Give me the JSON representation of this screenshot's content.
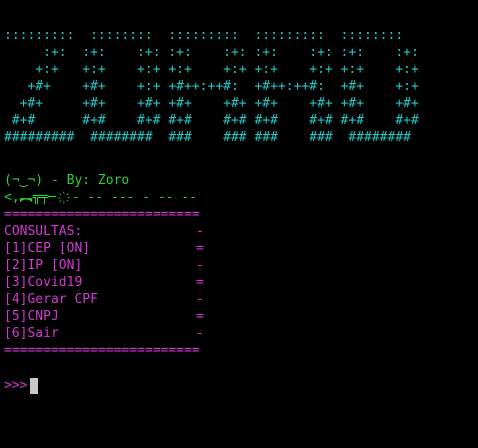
{
  "banner_art": [
    ":::::::::  ::::::::  :::::::::  :::::::::  ::::::::",
    "     :+:  :+:    :+: :+:    :+: :+:    :+: :+:    :+:",
    "    +:+   +:+    +:+ +:+    +:+ +:+    +:+ +:+    +:+",
    "   +#+    +#+    +:+ +#++:++#:  +#++:++#:  +#+    +:+",
    "  +#+     +#+    +#+ +#+    +#+ +#+    +#+ +#+    +#+",
    " #+#      #+#    #+# #+#    #+# #+#    #+# #+#    #+#",
    "#########  ########  ###    ### ###    ###  ########"
  ],
  "signature": {
    "face_text": "(¬‿¬) - By: Zoro",
    "weapon_text": "<,︻╦╤─ ҉ - -- --- - -- --"
  },
  "menu": {
    "divider": "=========================",
    "title": "CONSULTAS:",
    "title_mark": "-",
    "options": [
      {
        "label": "[1]CEP [ON]",
        "mark": "="
      },
      {
        "label": "[2]IP [ON]",
        "mark": "-"
      },
      {
        "label": "[3]Covid19",
        "mark": "="
      },
      {
        "label": "[4]Gerar CPF",
        "mark": "-"
      },
      {
        "label": "[5]CNPJ",
        "mark": "="
      },
      {
        "label": "[6]Sair",
        "mark": "-"
      }
    ]
  },
  "prompt": {
    "symbol": ">>>"
  },
  "colors": {
    "background": "#000000",
    "art": "#1ec8c8",
    "signature": "#2fd02f",
    "menu": "#d23ad2",
    "cursor": "#c8c8c8"
  }
}
